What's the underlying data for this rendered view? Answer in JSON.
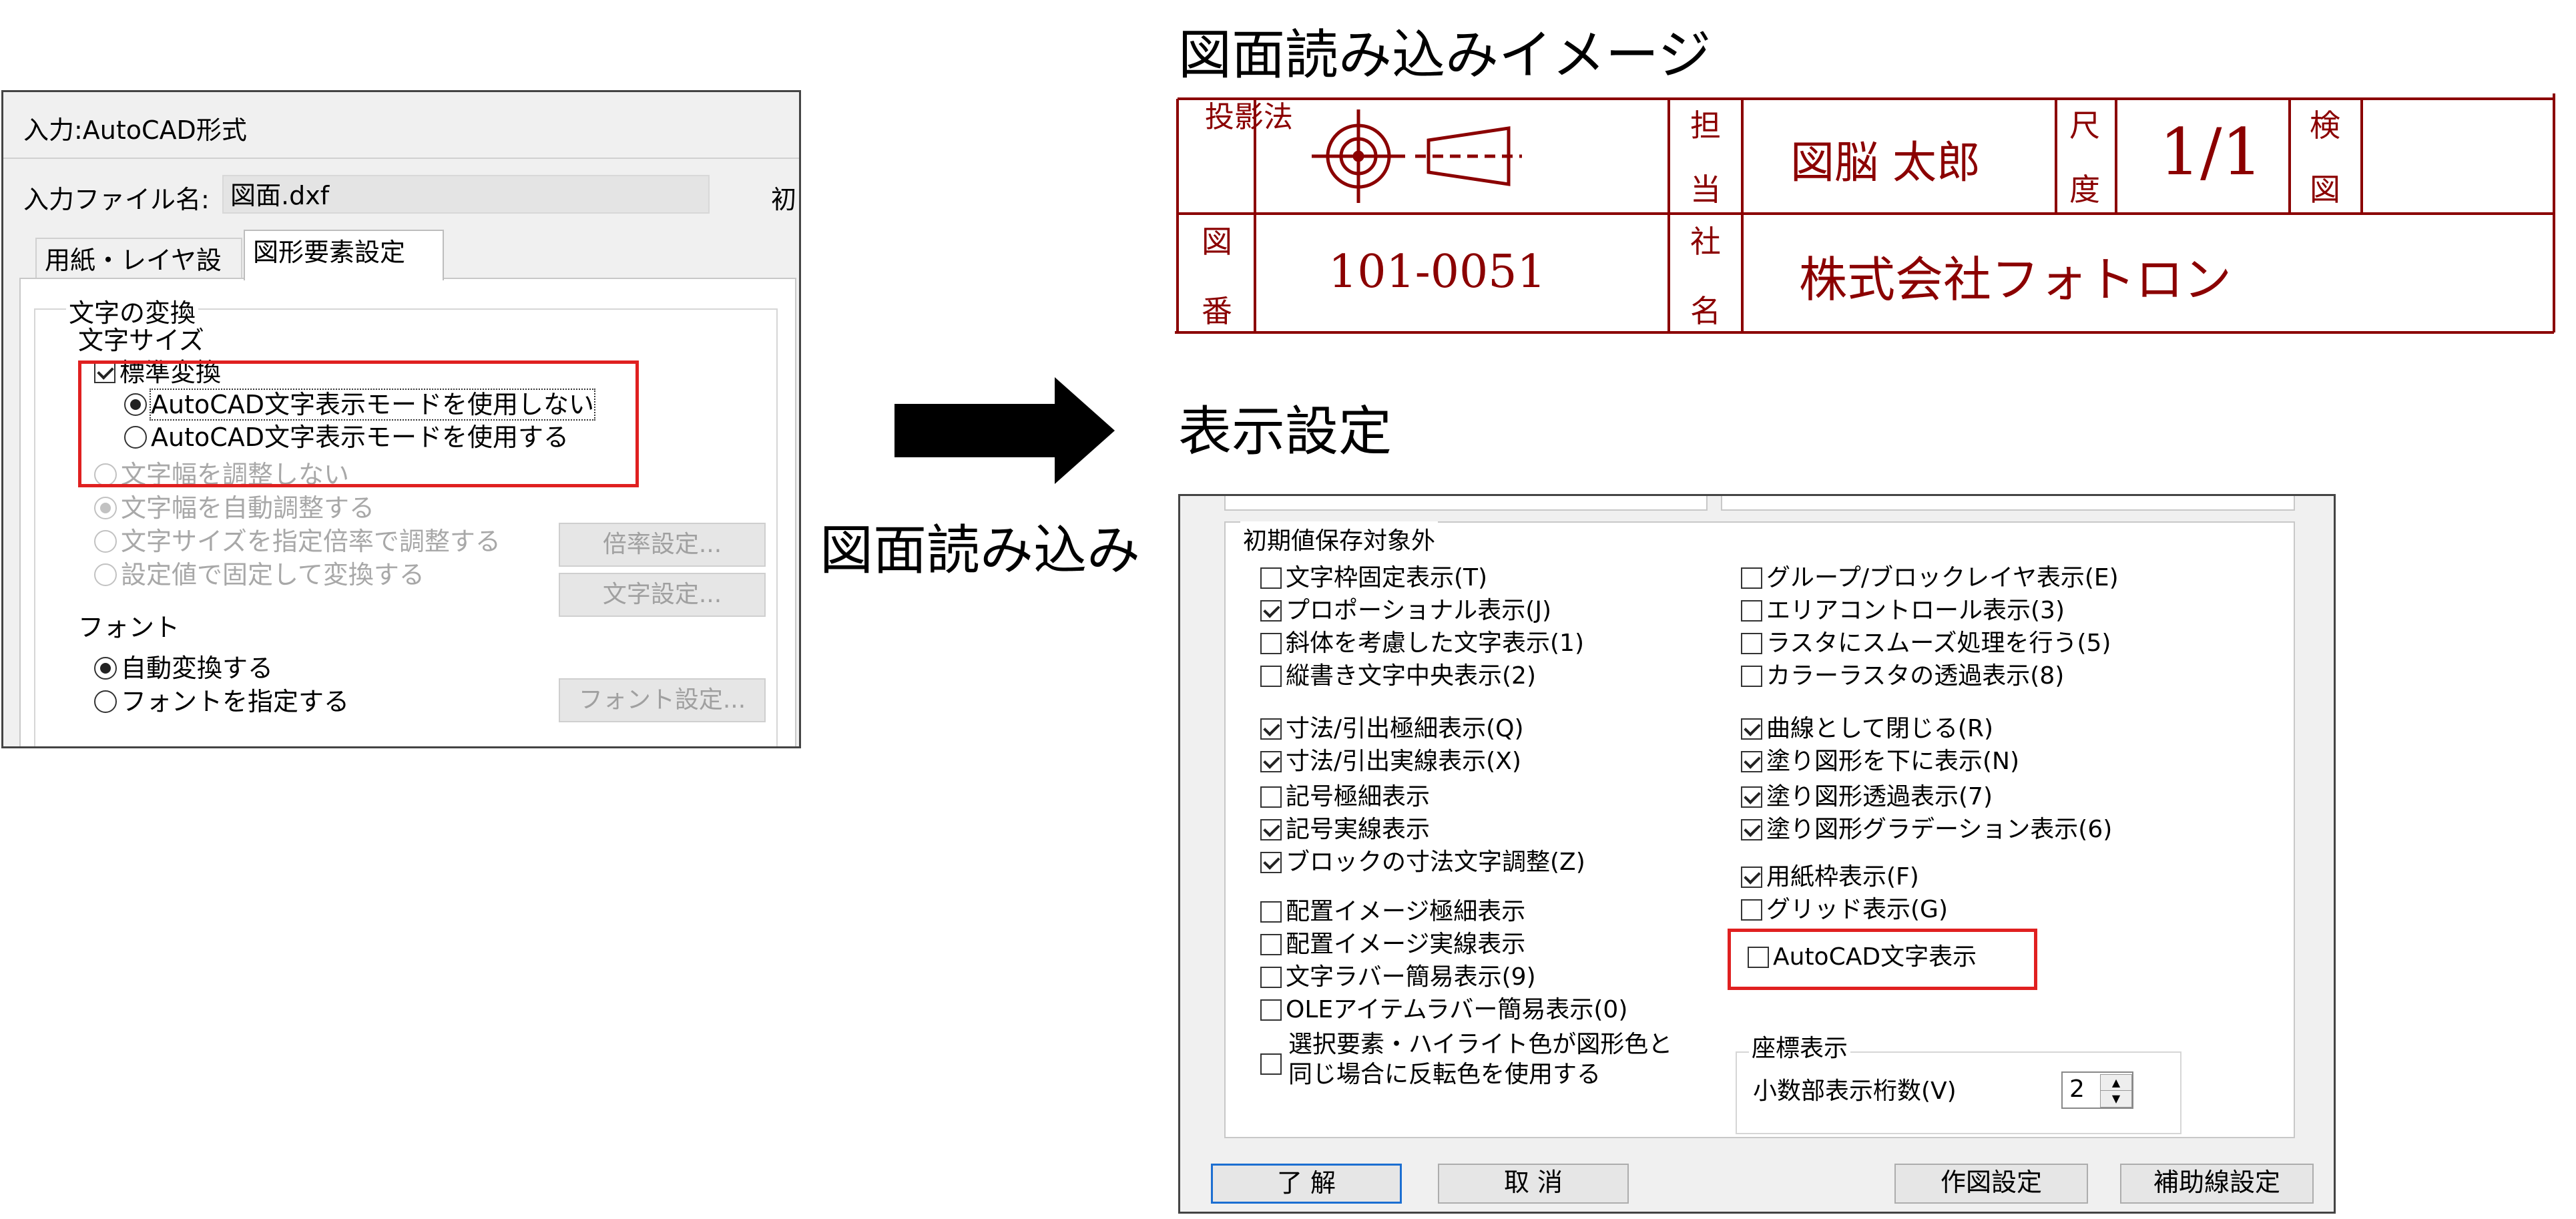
{
  "left_dialog": {
    "title": "入力:AutoCAD形式",
    "file_label": "入力ファイル名:",
    "file_value": "図面.dxf",
    "clipped_label": "初",
    "tabs": [
      {
        "label": "用紙・レイヤ設定"
      },
      {
        "label": "図形要素設定"
      }
    ],
    "group_title": "文字の変換",
    "size_label": "文字サイズ",
    "standard_convert": "標準変換",
    "radio_no_mode": "AutoCAD文字表示モードを使用しない",
    "radio_use_mode": "AutoCAD文字表示モードを使用する",
    "width_no_adjust": "文字幅を調整しない",
    "width_auto_adjust": "文字幅を自動調整する",
    "size_ratio": "文字サイズを指定倍率で調整する",
    "fixed_value": "設定値で固定して変換する",
    "ratio_button": "倍率設定...",
    "text_button": "文字設定...",
    "font_label": "フォント",
    "font_auto": "自動変換する",
    "font_specify": "フォントを指定する",
    "font_button": "フォント設定..."
  },
  "arrow_label": "図面読み込み",
  "title_block": {
    "heading": "図面読み込みイメージ",
    "projection": "投影法",
    "tanto_1": "担",
    "tanto_2": "当",
    "person": "図脳  太郎",
    "shaku_1": "尺",
    "shaku_2": "度",
    "scale": "1/1",
    "ken_1": "検",
    "ken_2": "図",
    "zu_1": "図",
    "ban_1": "番",
    "number": "101-0051",
    "sha_1": "社",
    "mei_1": "名",
    "company": "株式会社フォトロン",
    "color": "#8b0000"
  },
  "display_settings": {
    "heading": "表示設定",
    "group_title": "初期値保存対象外",
    "left_items": [
      {
        "label": "文字枠固定表示(T)",
        "checked": false
      },
      {
        "label": "プロポーショナル表示(J)",
        "checked": true
      },
      {
        "label": "斜体を考慮した文字表示(1)",
        "checked": false
      },
      {
        "label": "縦書き文字中央表示(2)",
        "checked": false
      },
      {
        "label": "寸法/引出極細表示(Q)",
        "checked": true
      },
      {
        "label": "寸法/引出実線表示(X)",
        "checked": true
      },
      {
        "label": "記号極細表示",
        "checked": false
      },
      {
        "label": "記号実線表示",
        "checked": true
      },
      {
        "label": "ブロックの寸法文字調整(Z)",
        "checked": true
      },
      {
        "label": "配置イメージ極細表示",
        "checked": false
      },
      {
        "label": "配置イメージ実線表示",
        "checked": false
      },
      {
        "label": "文字ラバー簡易表示(9)",
        "checked": false
      },
      {
        "label": "OLEアイテムラバー簡易表示(0)",
        "checked": false
      }
    ],
    "highlight_item_line1": "選択要素・ハイライト色が図形色と",
    "highlight_item_line2": "同じ場合に反転色を使用する",
    "right_items": [
      {
        "label": "グループ/ブロックレイヤ表示(E)",
        "checked": false
      },
      {
        "label": "エリアコントロール表示(3)",
        "checked": false
      },
      {
        "label": "ラスタにスムーズ処理を行う(5)",
        "checked": false
      },
      {
        "label": "カラーラスタの透過表示(8)",
        "checked": false
      },
      {
        "label": "曲線として閉じる(R)",
        "checked": true
      },
      {
        "label": "塗り図形を下に表示(N)",
        "checked": true
      },
      {
        "label": "塗り図形透過表示(7)",
        "checked": true
      },
      {
        "label": "塗り図形グラデーション表示(6)",
        "checked": true
      },
      {
        "label": "用紙枠表示(F)",
        "checked": true
      },
      {
        "label": "グリッド表示(G)",
        "checked": false
      },
      {
        "label": "AutoCAD文字表示",
        "checked": false
      }
    ],
    "coord_title": "座標表示",
    "decimal_label": "小数部表示桁数(V)",
    "decimal_value": "2",
    "ok_button": "了 解",
    "cancel_button": "取 消",
    "draw_settings_button": "作図設定",
    "aux_line_button": "補助線設定"
  },
  "colors": {
    "highlight": "#e02020",
    "title_block": "#8b0000"
  }
}
